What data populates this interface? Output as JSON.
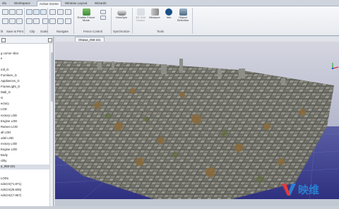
{
  "ribbon": {
    "tabs": [
      "dio",
      "Workspace",
      "Active Scene",
      "Window Layout",
      "Wizards"
    ],
    "active_tab": "Active Scene",
    "groups": [
      "lit",
      "Save & Print",
      "Clip",
      "Scale",
      "Navigate",
      "Fence Control",
      "Synchronize",
      "Tools"
    ],
    "buttons": {
      "enable_fence_mode": "Enable Fence Mode",
      "holospin": "HoloSpin",
      "scene_grid_cursor": "3D Grid Cursor",
      "measure": "Measure",
      "info": "Info",
      "object_selection": "Object Selection"
    }
  },
  "tree": {
    "header": "g corner slice",
    "items": [
      "e",
      "",
      "roll_G",
      "Furniture_G",
      "Appliances_G",
      "FrameLight_G",
      "Wall_G",
      "G",
      "ectory",
      "LOD",
      "rectory LOD",
      "Engine LOD",
      "Ramen LOD",
      "all LOD",
      "odel LOD",
      "rectory LOD",
      "Engine LOD",
      "Body",
      "cility",
      "a_058-221",
      "",
      "LODs",
      "ndsCH(71.871)",
      "ndsCH(25.935)",
      "ndsCH(17.967)"
    ],
    "selected_index": 19
  },
  "viewport": {
    "tab_label": "Ottawa_058-221"
  },
  "watermark": {
    "logo_letter": "V",
    "text": "映维"
  },
  "colors": {
    "sky_top": "#c9cbd8",
    "ground_purple": "#3a3c8c",
    "accent_blue": "#2b7fd1"
  }
}
